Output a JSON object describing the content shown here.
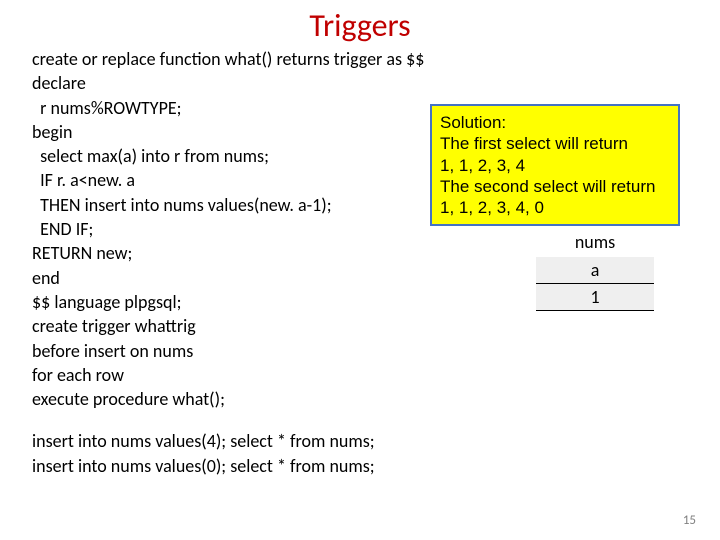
{
  "title": "Triggers",
  "code": "create or replace function what() returns trigger as $$\ndeclare\n  r nums%ROWTYPE;\nbegin\n  select max(a) into r from nums;\n  IF r. a<new. a\n  THEN insert into nums values(new. a-1);\n  END IF;\nRETURN new;\nend\n$$ language plpgsql;\ncreate trigger whattrig\nbefore insert on nums\nfor each row\nexecute procedure what();",
  "inserts": "insert into nums values(4); select * from nums;\ninsert into nums values(0); select * from nums;",
  "solution": {
    "heading": "Solution:",
    "line1": "The first select will return",
    "vals1": "1, 1, 2, 3, 4",
    "line2": "The second select will return",
    "vals2": "1, 1, 2, 3, 4, 0"
  },
  "nums": {
    "label": "nums",
    "col": "a",
    "val": "1"
  },
  "page": "15"
}
